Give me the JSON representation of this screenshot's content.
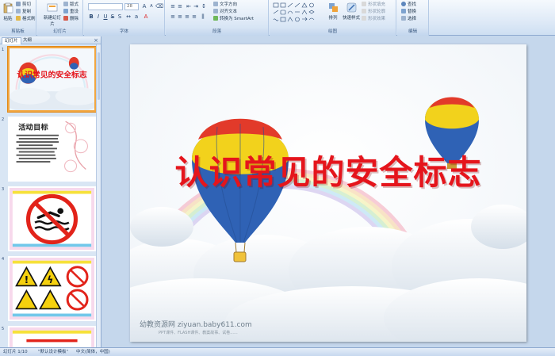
{
  "ribbon": {
    "clipboard": {
      "paste_label": "粘贴",
      "cut_label": "剪切",
      "copy_label": "复制",
      "format_painter_label": "格式刷",
      "group_label": "剪贴板"
    },
    "slides": {
      "new_slide_label": "新建幻灯片",
      "layout_label": "版式",
      "reset_label": "重设",
      "delete_label": "删除",
      "group_label": "幻灯片"
    },
    "font": {
      "font_size": "28",
      "group_label": "字体"
    },
    "paragraph": {
      "text_direction_label": "文字方向",
      "align_text_label": "对齐文本",
      "smartart_label": "转换为 SmartArt",
      "group_label": "段落"
    },
    "drawing": {
      "arrange_label": "排列",
      "quick_styles_label": "快速样式",
      "shape_fill_label": "形状填充",
      "shape_outline_label": "形状轮廓",
      "shape_effects_label": "形状效果",
      "group_label": "绘图"
    },
    "editing": {
      "find_label": "查找",
      "replace_label": "替换",
      "select_label": "选择",
      "group_label": "编辑"
    }
  },
  "left_panel": {
    "tab_slides": "幻灯片",
    "tab_outline": "大纲",
    "thumbnails": [
      {
        "number": "1",
        "title": "认识常见的安全标志"
      },
      {
        "number": "2",
        "title": "活动目标"
      },
      {
        "number": "3",
        "title": ""
      },
      {
        "number": "4",
        "title": ""
      },
      {
        "number": "5",
        "title": ""
      }
    ]
  },
  "slide": {
    "title": "认识常见的安全标志",
    "watermark": "幼教资源网 ziyuan.baby611.com",
    "watermark_sub": "PPT课件、FLASH课件、教案故事、试卷......"
  },
  "statusbar": {
    "slide_position": "幻灯片 1/10",
    "theme": "\"默认设计模板\"",
    "language": "中文(简体，中国)"
  },
  "colors": {
    "title_red": "#e5151c",
    "selection_orange": "#f2a640",
    "ribbon_bg": "#dfeaf7"
  }
}
